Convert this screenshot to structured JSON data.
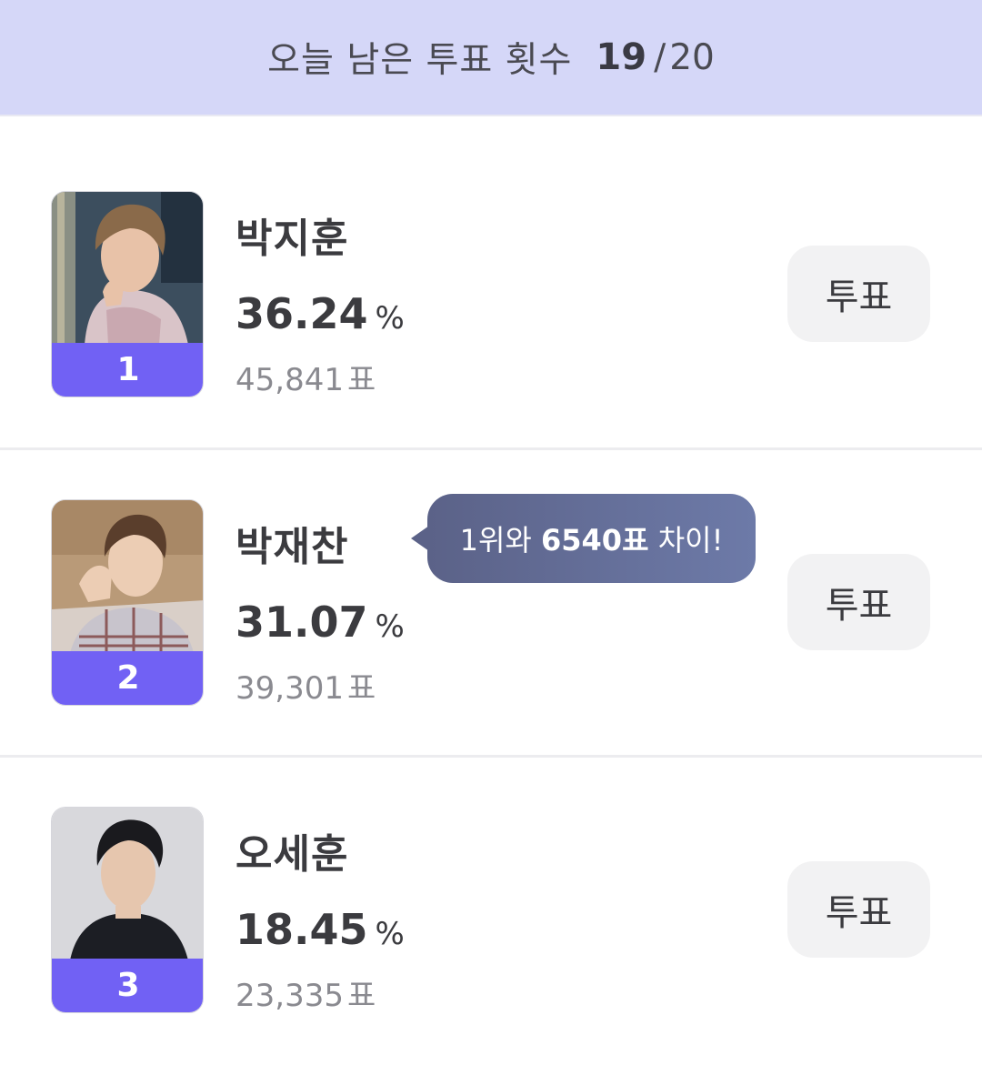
{
  "banner": {
    "label": "오늘 남은 투표 횟수",
    "remaining": "19",
    "separator": "/",
    "total": "20"
  },
  "candidates": [
    {
      "rank": "1",
      "name": "박지훈",
      "percent": "36.24",
      "percent_unit": "%",
      "votes": "45,841",
      "votes_unit": "표",
      "vote_button": "투표"
    },
    {
      "rank": "2",
      "name": "박재찬",
      "percent": "31.07",
      "percent_unit": "%",
      "votes": "39,301",
      "votes_unit": "표",
      "vote_button": "투표"
    },
    {
      "rank": "3",
      "name": "오세훈",
      "percent": "18.45",
      "percent_unit": "%",
      "votes": "23,335",
      "votes_unit": "표",
      "vote_button": "투표"
    }
  ],
  "gap_tooltip": {
    "prefix": "1위와",
    "gap": "6540표",
    "suffix": "차이!"
  },
  "colors": {
    "banner_bg": "#d5d7f8",
    "rank_band": "#7161f4",
    "tooltip": "#5b6288",
    "button_bg": "#f2f2f3"
  }
}
